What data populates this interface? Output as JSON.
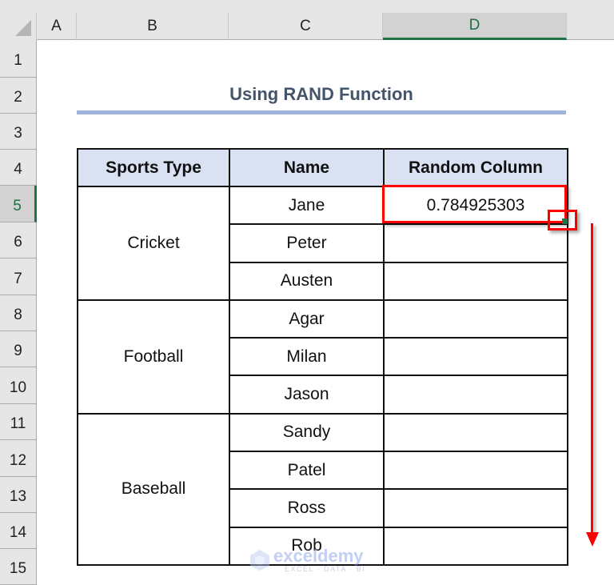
{
  "spreadsheet": {
    "columns": [
      {
        "label": "A",
        "selected": false
      },
      {
        "label": "B",
        "selected": false
      },
      {
        "label": "C",
        "selected": false
      },
      {
        "label": "D",
        "selected": true
      }
    ],
    "rows": [
      "1",
      "2",
      "3",
      "4",
      "5",
      "6",
      "7",
      "8",
      "9",
      "10",
      "11",
      "12",
      "13",
      "14",
      "15"
    ],
    "selected_row": "5",
    "accent_color": "#217346"
  },
  "sheet": {
    "title": "Using RAND Function",
    "table": {
      "headers": [
        "Sports Type",
        "Name",
        "Random Column"
      ],
      "groups": [
        {
          "sport": "Cricket",
          "names": [
            "Jane",
            "Peter",
            "Austen"
          ]
        },
        {
          "sport": "Football",
          "names": [
            "Agar",
            "Milan",
            "Jason"
          ]
        },
        {
          "sport": "Baseball",
          "names": [
            "Sandy",
            "Patel",
            "Ross",
            "Rob"
          ]
        }
      ],
      "random_values": [
        "0.784925303",
        "",
        "",
        "",
        "",
        "",
        "",
        "",
        "",
        ""
      ]
    },
    "annotation_color": "#ff0000"
  },
  "watermark": {
    "name": "exceldemy",
    "tagline": "EXCEL · DATA · BI"
  }
}
